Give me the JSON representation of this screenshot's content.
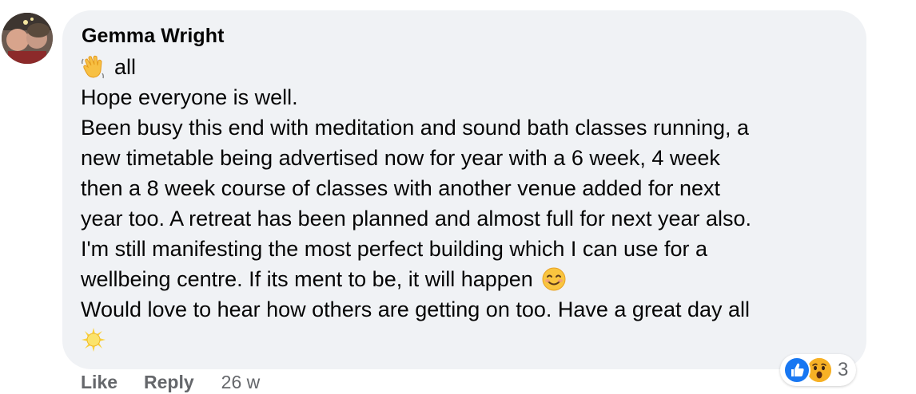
{
  "comment": {
    "author": "Gemma Wright",
    "lines": [
      "all",
      "Hope everyone is well.",
      "Been busy this end with meditation and sound bath classes running, a",
      "new timetable being advertised now for year with a 6 week, 4 week",
      "then a 8 week course of classes with another venue added for next",
      "year too. A retreat has been planned and almost full for next year also.",
      "I'm still manifesting the most perfect building which I can use for a",
      "wellbeing centre. If its ment to be, it will happen",
      "Would love to hear how others are getting on too. Have a great day all"
    ],
    "emojis": {
      "line1_prefix": "waving-hand-emoji",
      "line8_suffix": "smiling-face-emoji",
      "final_line": "sun-emoji"
    }
  },
  "actions": {
    "like_label": "Like",
    "reply_label": "Reply",
    "timestamp": "26 w"
  },
  "reactions": {
    "icons": [
      "like-reaction-icon",
      "wow-reaction-icon"
    ],
    "count": "3"
  },
  "colors": {
    "bubble_bg": "#f0f2f5",
    "text": "#050505",
    "secondary_text": "#65676b",
    "like_blue": "#1877f2",
    "wow_yellow": "#f7b125"
  }
}
